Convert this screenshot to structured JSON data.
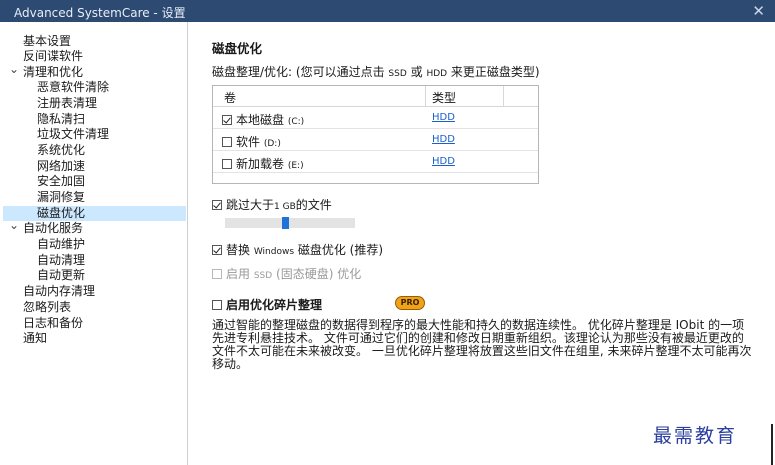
{
  "window": {
    "title": "Advanced SystemCare - 设置",
    "close_glyph": "✕"
  },
  "sidebar": {
    "items": [
      {
        "label": "基本设置",
        "level": 0
      },
      {
        "label": "反间谍软件",
        "level": 0
      },
      {
        "label": "清理和优化",
        "level": 0,
        "expanded": true
      },
      {
        "label": "恶意软件清除",
        "level": 1
      },
      {
        "label": "注册表清理",
        "level": 1
      },
      {
        "label": "隐私清扫",
        "level": 1
      },
      {
        "label": "垃圾文件清理",
        "level": 1
      },
      {
        "label": "系统优化",
        "level": 1
      },
      {
        "label": "网络加速",
        "level": 1
      },
      {
        "label": "安全加固",
        "level": 1
      },
      {
        "label": "漏洞修复",
        "level": 1
      },
      {
        "label": "磁盘优化",
        "level": 1,
        "selected": true
      },
      {
        "label": "自动化服务",
        "level": 0,
        "expanded": true
      },
      {
        "label": "自动维护",
        "level": 1
      },
      {
        "label": "自动清理",
        "level": 1
      },
      {
        "label": "自动更新",
        "level": 1
      },
      {
        "label": "自动内存清理",
        "level": 0
      },
      {
        "label": "忽略列表",
        "level": 0
      },
      {
        "label": "日志和备份",
        "level": 0
      },
      {
        "label": "通知",
        "level": 0
      }
    ]
  },
  "main": {
    "section_title": "磁盘优化",
    "subtitle_a": "磁盘整理/优化: (您可以通过点击",
    "subtitle_ssd": "SSD",
    "subtitle_or": "或",
    "subtitle_hdd": "HDD",
    "subtitle_b": "来更正磁盘类型)",
    "table": {
      "col_volume": "卷",
      "col_type": "类型",
      "rows": [
        {
          "name": "本地磁盘",
          "drive": "(C:)",
          "type": "HDD",
          "checked": true
        },
        {
          "name": "软件",
          "drive": "(D:)",
          "type": "HDD",
          "checked": false
        },
        {
          "name": "新加载卷",
          "drive": "(E:)",
          "type": "HDD",
          "checked": false
        }
      ]
    },
    "skip_large": {
      "prefix": "跳过大于",
      "size": "1 GB",
      "suffix": "的文件",
      "checked": true
    },
    "slider_level": 0.46,
    "replace_defrag": {
      "prefix": "替换",
      "mid": "Windows",
      "suffix": "磁盘优化 (推荐)",
      "checked": true
    },
    "enable_ssd": {
      "prefix": "启用",
      "mid": "SSD",
      "suffix": "(固态硬盘) 优化",
      "checked": false,
      "disabled": true
    },
    "smart_defrag": {
      "label": "启用优化碎片整理",
      "checked": false,
      "badge": "PRO"
    },
    "description": "通过智能的整理磁盘的数据得到程序的最大性能和持久的数据连续性。 优化碎片整理是 IObit 的一项先进专利悬挂技术。 文件可通过它们的创建和修改日期重新组织。该理论认为那些没有被最近更改的文件不太可能在未来被改变。 一旦优化碎片整理将放置这些旧文件在组里, 未来碎片整理不太可能再次移动。"
  },
  "watermark": "最需教育"
}
